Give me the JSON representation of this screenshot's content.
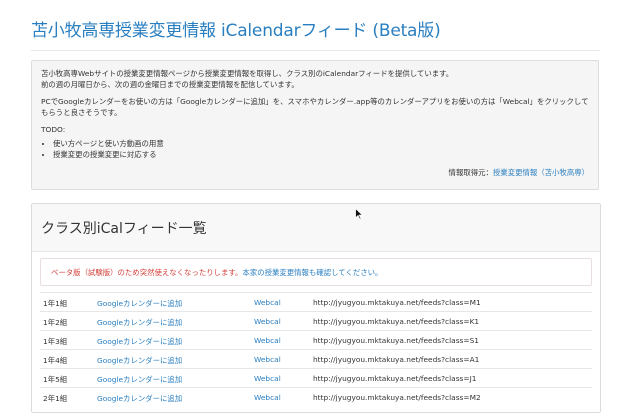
{
  "page": {
    "title": "苫小牧高専授業変更情報 iCalendarフィード (Beta版)"
  },
  "info": {
    "intro_line1": "苫小牧高専Webサイトの授業変更情報ページから授業変更情報を取得し、クラス別のiCalendarフィードを提供しています。",
    "intro_line2": "前の週の月曜日から、次の週の金曜日までの授業変更情報を配信しています。",
    "usage": "PCでGoogleカレンダーをお使いの方は「Googleカレンダーに追加」を、スマホやカレンダー.app等のカレンダーアプリをお使いの方は「Webcal」をクリックしてもらうと良さそうです。",
    "todo_label": "TODO:",
    "todo_items": [
      "使い方ページと使い方動画の用意",
      "授業変更の授業変更に対応する"
    ],
    "source_label": "情報取得元：",
    "source_link": "授業変更情報（苫小牧高専）"
  },
  "feeds": {
    "heading": "クラス別iCalフィード一覧",
    "warning_text": "ベータ版（試験版）のため突然使えなくなったりします。",
    "warning_link": "本家の授業変更情報も確認してください。",
    "rows": [
      {
        "class": "1年1組",
        "google": "Googleカレンダーに追加",
        "webcal": "Webcal",
        "url": "http://jyugyou.mktakuya.net/feeds?class=M1"
      },
      {
        "class": "1年2組",
        "google": "Googleカレンダーに追加",
        "webcal": "Webcal",
        "url": "http://jyugyou.mktakuya.net/feeds?class=K1"
      },
      {
        "class": "1年3組",
        "google": "Googleカレンダーに追加",
        "webcal": "Webcal",
        "url": "http://jyugyou.mktakuya.net/feeds?class=S1"
      },
      {
        "class": "1年4組",
        "google": "Googleカレンダーに追加",
        "webcal": "Webcal",
        "url": "http://jyugyou.mktakuya.net/feeds?class=A1"
      },
      {
        "class": "1年5組",
        "google": "Googleカレンダーに追加",
        "webcal": "Webcal",
        "url": "http://jyugyou.mktakuya.net/feeds?class=J1"
      },
      {
        "class": "2年1組",
        "google": "Googleカレンダーに追加",
        "webcal": "Webcal",
        "url": "http://jyugyou.mktakuya.net/feeds?class=M2"
      }
    ]
  }
}
